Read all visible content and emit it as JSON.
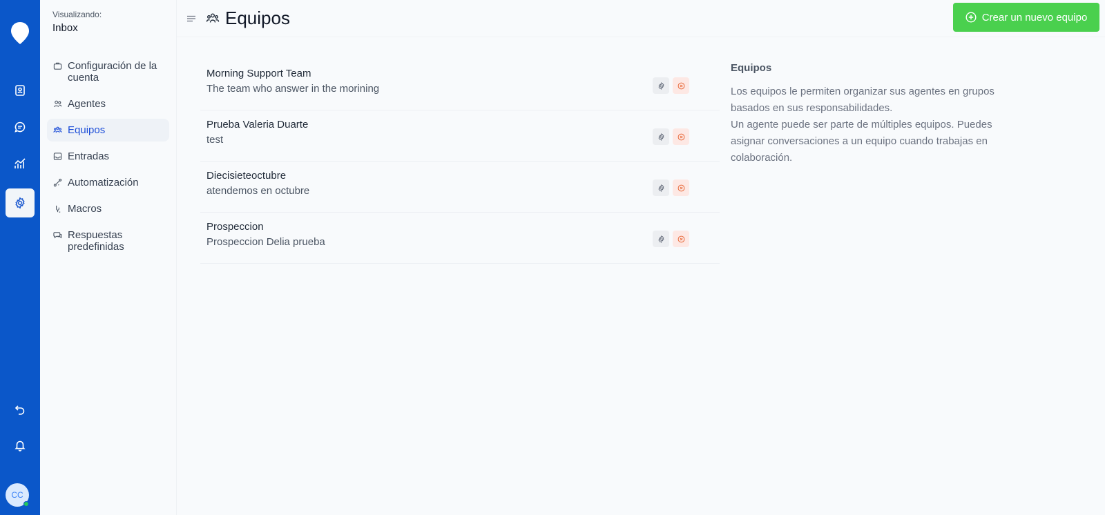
{
  "rail": {
    "nav": [
      {
        "icon": "contacts-icon"
      },
      {
        "icon": "conversations-icon"
      },
      {
        "icon": "reports-icon"
      },
      {
        "icon": "settings-icon",
        "active": true
      }
    ],
    "bottom": [
      {
        "icon": "back-arrow-icon"
      },
      {
        "icon": "bell-icon"
      }
    ],
    "avatar_initials": "CC"
  },
  "sidebar": {
    "viewing_label": "Visualizando:",
    "viewing_value": "Inbox",
    "items": [
      {
        "label": "Configuración de la cuenta",
        "icon": "briefcase-icon"
      },
      {
        "label": "Agentes",
        "icon": "people-icon"
      },
      {
        "label": "Equipos",
        "icon": "team-icon",
        "active": true
      },
      {
        "label": "Entradas",
        "icon": "inbox-icon"
      },
      {
        "label": "Automatización",
        "icon": "automation-icon"
      },
      {
        "label": "Macros",
        "icon": "macros-icon"
      },
      {
        "label": "Respuestas predefinidas",
        "icon": "chat-icon"
      }
    ]
  },
  "header": {
    "title": "Equipos",
    "create_button_label": "Crear un nuevo equipo"
  },
  "teams": [
    {
      "name": "Morning Support Team",
      "description": "The team who answer in the morining"
    },
    {
      "name": "Prueba Valeria Duarte",
      "description": "test"
    },
    {
      "name": "Diecisieteoctubre",
      "description": "atendemos en octubre"
    },
    {
      "name": "Prospeccion",
      "description": "Prospeccion Delia prueba"
    }
  ],
  "info": {
    "title": "Equipos",
    "line1": "Los equipos le permiten organizar sus agentes en grupos basados en sus responsabilidades.",
    "line2": "Un agente puede ser parte de múltiples equipos. Puedes asignar conversaciones a un equipo cuando trabajas en colaboración."
  },
  "colors": {
    "rail": "#0b57c9",
    "primary_button": "#4ad04e",
    "active_item": "#1d4ed8"
  }
}
